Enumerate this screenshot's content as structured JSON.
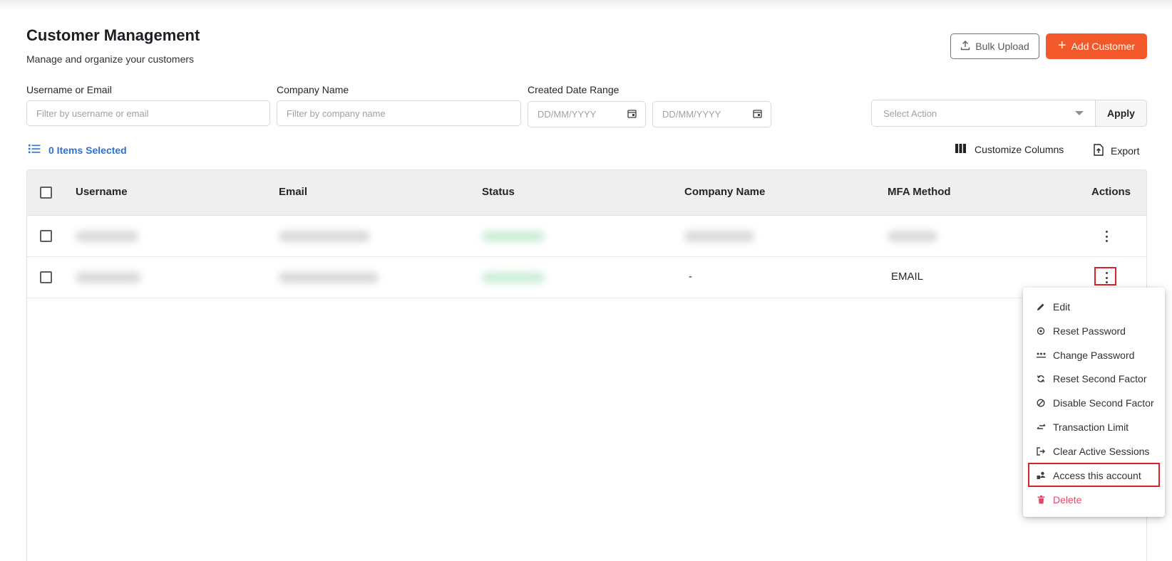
{
  "header": {
    "title": "Customer Management",
    "subtitle": "Manage and organize your customers",
    "bulk_upload_label": "Bulk Upload",
    "add_customer_label": "Add Customer"
  },
  "filters": {
    "username_label": "Username or Email",
    "username_placeholder": "Filter by username or email",
    "company_label": "Company Name",
    "company_placeholder": "Filter by company name",
    "date_label": "Created Date Range",
    "date_from_placeholder": "DD/MM/YYYY",
    "date_to_placeholder": "DD/MM/YYYY",
    "action_placeholder": "Select Action",
    "apply_label": "Apply"
  },
  "toolbar": {
    "selected_text": "0 Items Selected",
    "customize_label": "Customize Columns",
    "export_label": "Export"
  },
  "table": {
    "columns": [
      "Username",
      "Email",
      "Status",
      "Company Name",
      "MFA Method",
      "Actions"
    ],
    "rows": [
      {
        "company": "",
        "mfa": ""
      },
      {
        "company": "-",
        "mfa": "EMAIL"
      }
    ]
  },
  "actions_menu": {
    "items": [
      {
        "label": "Edit",
        "icon": "pencil-icon"
      },
      {
        "label": "Reset Password",
        "icon": "reset-lock-icon"
      },
      {
        "label": "Change Password",
        "icon": "password-dots-icon"
      },
      {
        "label": "Reset Second Factor",
        "icon": "refresh-icon"
      },
      {
        "label": "Disable Second Factor",
        "icon": "block-icon"
      },
      {
        "label": "Transaction Limit",
        "icon": "swap-arrows-icon"
      },
      {
        "label": "Clear Active Sessions",
        "icon": "logout-icon"
      },
      {
        "label": "Access this account",
        "icon": "user-switch-icon"
      },
      {
        "label": "Delete",
        "icon": "trash-icon"
      }
    ]
  },
  "colors": {
    "accent": "#f2582a",
    "link": "#2a72d8",
    "danger": "#e64664",
    "highlight": "#d9232a"
  }
}
